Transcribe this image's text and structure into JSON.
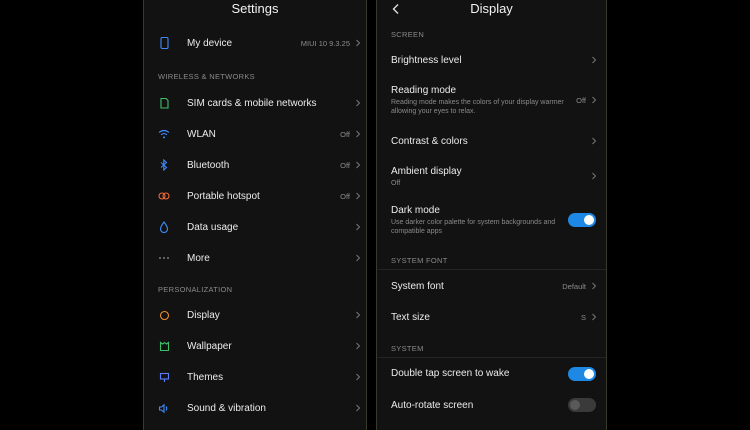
{
  "colors": {
    "accent": "#1e88e5",
    "background": "#121212",
    "text": "#ececec",
    "secondary": "#8a8a8a"
  },
  "settings": {
    "title": "Settings",
    "my_device": {
      "label": "My device",
      "value": "MIUI 10 9.3.25",
      "icon": "phone-icon"
    },
    "wireless_header": "WIRELESS & NETWORKS",
    "wireless_items": [
      {
        "label": "SIM cards & mobile networks",
        "value": "",
        "icon": "sim-card-icon"
      },
      {
        "label": "WLAN",
        "value": "Off",
        "icon": "wifi-icon"
      },
      {
        "label": "Bluetooth",
        "value": "Off",
        "icon": "bluetooth-icon"
      },
      {
        "label": "Portable hotspot",
        "value": "Off",
        "icon": "hotspot-icon"
      },
      {
        "label": "Data usage",
        "value": "",
        "icon": "data-usage-icon"
      },
      {
        "label": "More",
        "value": "",
        "icon": "more-icon"
      }
    ],
    "personalization_header": "PERSONALIZATION",
    "personalization_items": [
      {
        "label": "Display",
        "icon": "display-icon"
      },
      {
        "label": "Wallpaper",
        "icon": "wallpaper-icon"
      },
      {
        "label": "Themes",
        "icon": "themes-icon"
      },
      {
        "label": "Sound & vibration",
        "icon": "sound-icon"
      }
    ]
  },
  "display": {
    "title": "Display",
    "screen_header": "SCREEN",
    "brightness": {
      "label": "Brightness level"
    },
    "reading_mode": {
      "label": "Reading mode",
      "sub": "Reading mode makes the colors of your display warmer allowing your eyes to relax.",
      "value": "Off"
    },
    "contrast": {
      "label": "Contrast & colors"
    },
    "ambient": {
      "label": "Ambient display",
      "sub": "Off"
    },
    "dark_mode": {
      "label": "Dark mode",
      "sub": "Use darker color palette for system backgrounds and compatible apps",
      "enabled": true
    },
    "system_font_header": "SYSTEM FONT",
    "system_font": {
      "label": "System font",
      "value": "Default"
    },
    "text_size": {
      "label": "Text size",
      "value": "S"
    },
    "system_header": "SYSTEM",
    "double_tap": {
      "label": "Double tap screen to wake",
      "enabled": true
    },
    "auto_rotate": {
      "label": "Auto-rotate screen",
      "enabled": false
    }
  }
}
